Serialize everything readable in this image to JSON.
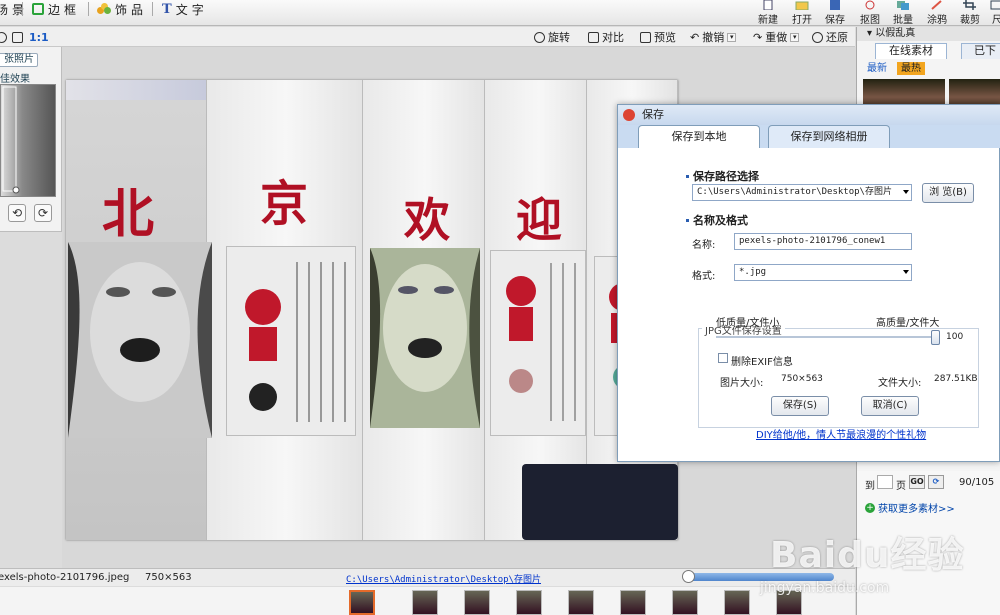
{
  "top_tabs": [
    {
      "name": "scene",
      "label": "场景"
    },
    {
      "name": "frame",
      "label": "边框"
    },
    {
      "name": "decoration",
      "label": "饰品"
    },
    {
      "name": "text",
      "label": "文字"
    }
  ],
  "right_tools": [
    "新建",
    "打开",
    "保存",
    "抠图",
    "批量",
    "涂鸦",
    "裁剪",
    "尺"
  ],
  "subbar": {
    "zoom_ratio": "1:1",
    "rotate": "旋转",
    "compare": "对比",
    "preview": "预览",
    "undo": "撤销",
    "redo": "重做",
    "restore": "还原"
  },
  "left_panel": {
    "button": "张照片",
    "label": "佳效果"
  },
  "canvas": {
    "characters": [
      "北",
      "京",
      "欢",
      "迎"
    ]
  },
  "status": {
    "filename": "exels-photo-2101796.jpeg",
    "dimensions": "750×563",
    "path": "C:\\Users\\Administrator\\Desktop\\存图片"
  },
  "right_panel": {
    "title": "以假乱真",
    "tabs": [
      "在线素材",
      "已下"
    ],
    "sub_tabs": [
      "最新",
      "最热"
    ],
    "goto_prefix": "到",
    "goto_suffix": "页",
    "go_label": "GO",
    "page_count": "90/105",
    "more_link": "获取更多素材>>"
  },
  "dialog": {
    "title": "保存",
    "tabs": [
      "保存到本地",
      "保存到网络相册"
    ],
    "path_section": "保存路径选择",
    "path_value": "C:\\Users\\Administrator\\Desktop\\存图片",
    "browse_label": "浏 览(B)",
    "name_section": "名称及格式",
    "name_label": "名称:",
    "name_value": "pexels-photo-2101796_conew1",
    "format_label": "格式:",
    "format_value": "*.jpg",
    "jpg_group_title": "JPG文件保存设置",
    "low_quality": "低质量/文件小",
    "high_quality": "高质量/文件大",
    "quality_value": "100",
    "quality_level": 100,
    "remove_exif": "删除EXIF信息",
    "image_size_label": "图片大小:",
    "image_size_value": "750×563",
    "file_size_label": "文件大小:",
    "file_size_value": "287.51KB",
    "save_button": "保存(S)",
    "cancel_button": "取消(C)",
    "promo_link": "DIY给他/他，情人节最浪漫的个性礼物"
  },
  "watermark": {
    "logo": "Baidu经验",
    "url": "jingyan.baidu.com"
  }
}
